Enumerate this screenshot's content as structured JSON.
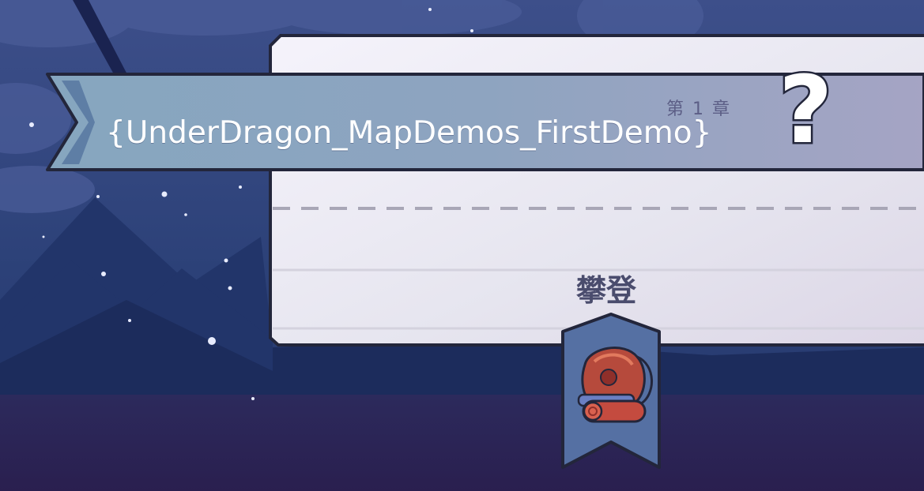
{
  "header": {
    "chapter_label": "第 1 章",
    "map_title": "{UnderDragon_MapDemos_FirstDemo}",
    "unknown_symbol": "?"
  },
  "card": {
    "skill_label": "攀登",
    "skill_badge_icon": "backpack-icon"
  },
  "colors": {
    "night_sky": "#2c3f74",
    "ground": "#2a2557",
    "banner": "#8da6bf",
    "card": "#eceaf3",
    "badge": "#5570a3",
    "outline": "#23263b"
  }
}
